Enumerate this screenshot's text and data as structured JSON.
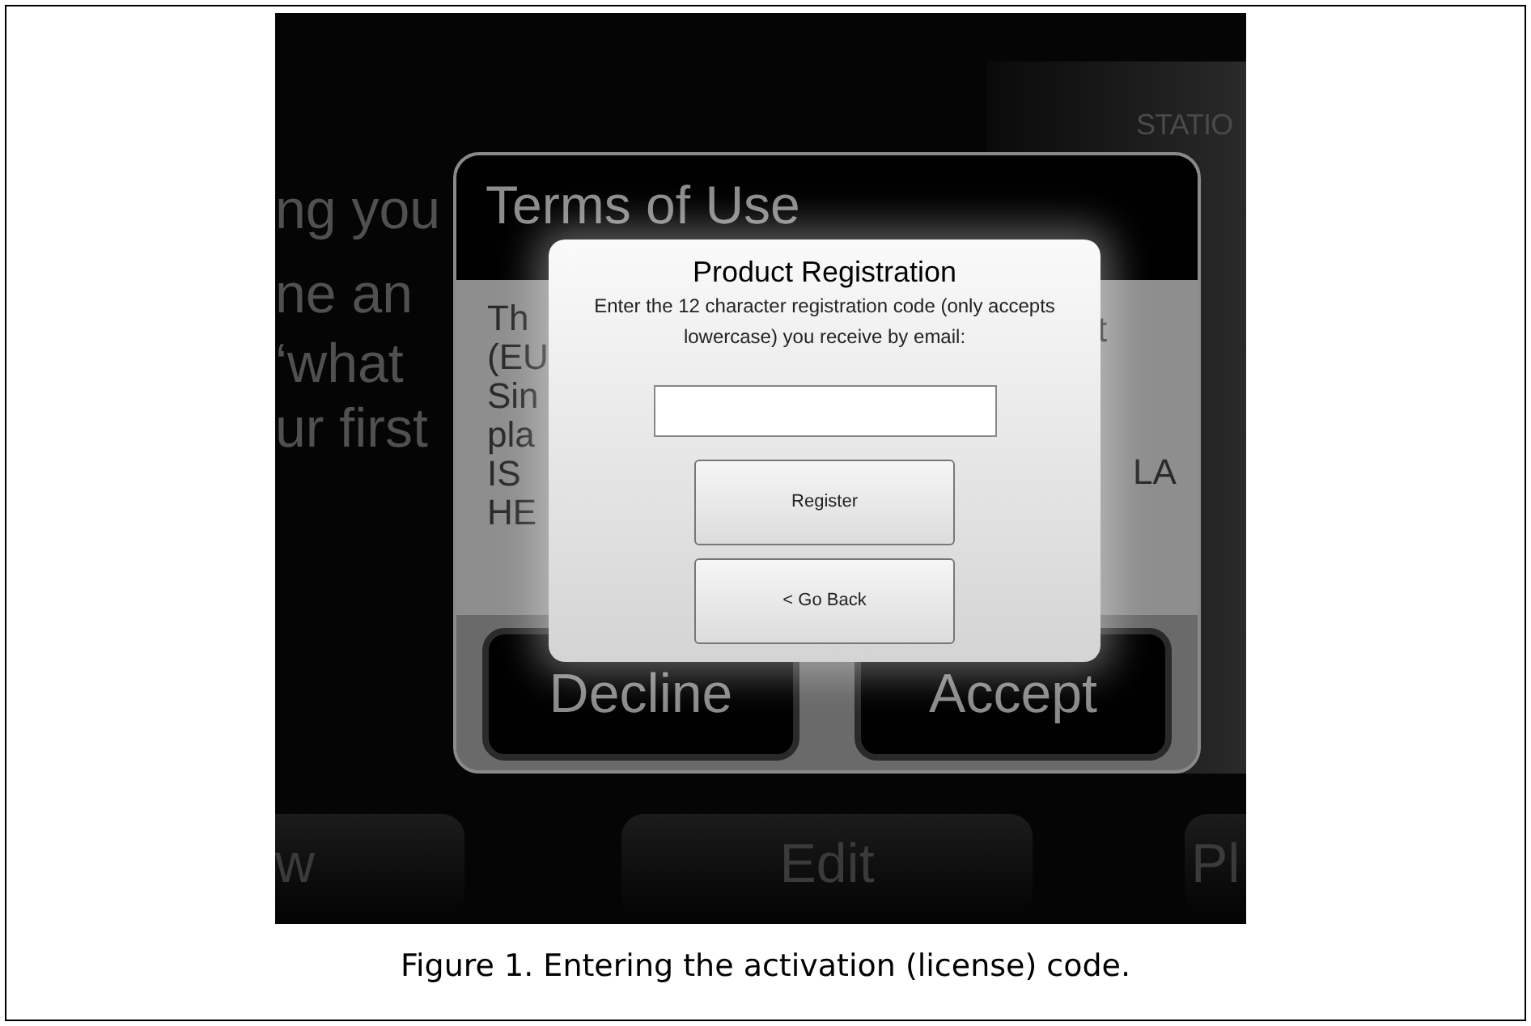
{
  "screenshot": {
    "background_texts": [
      "ng you",
      "ne an",
      "‘what",
      "ur first"
    ],
    "corner_label": "STATIO",
    "terms_dialog": {
      "title": "Terms of Use",
      "body_left": [
        "Th",
        "(EU",
        "Sin",
        "pla",
        "IS",
        "HE"
      ],
      "body_right": [
        "t",
        "LA"
      ],
      "buttons": [
        "Decline",
        "Accept"
      ]
    },
    "registration_dialog": {
      "title": "Product Registration",
      "instructions": "Enter the 12 character registration code (only accepts lowercase) you receive by email:",
      "buttons": [
        "Register",
        "< Go Back"
      ]
    },
    "bottom_buttons": [
      "w",
      "Edit",
      "Pl"
    ]
  },
  "caption": "Figure 1. Entering the activation (license) code."
}
